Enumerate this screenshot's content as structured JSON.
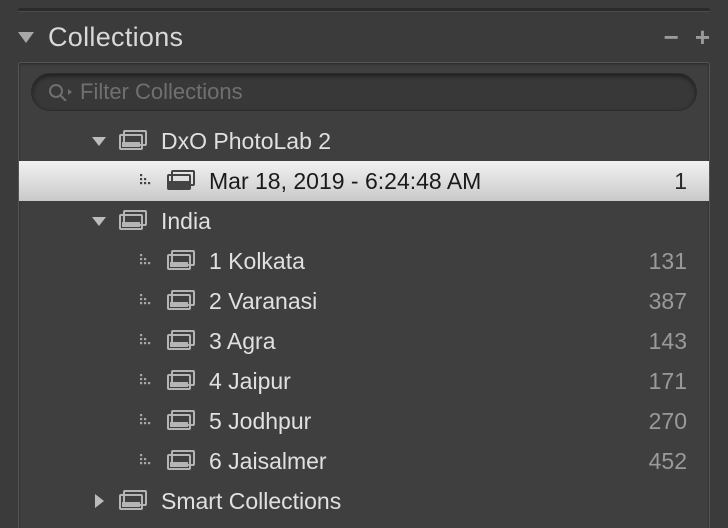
{
  "header": {
    "title": "Collections"
  },
  "filter": {
    "placeholder": "Filter Collections"
  },
  "tree": {
    "items": [
      {
        "kind": "set",
        "expanded": true,
        "depth": 0,
        "label": "DxO PhotoLab 2",
        "selected": false
      },
      {
        "kind": "collection",
        "depth": 1,
        "label": "Mar 18, 2019 - 6:24:48 AM",
        "count": "1",
        "selected": true
      },
      {
        "kind": "set",
        "expanded": true,
        "depth": 0,
        "label": "India",
        "selected": false
      },
      {
        "kind": "collection",
        "depth": 1,
        "label": "1 Kolkata",
        "count": "131",
        "selected": false
      },
      {
        "kind": "collection",
        "depth": 1,
        "label": "2 Varanasi",
        "count": "387",
        "selected": false
      },
      {
        "kind": "collection",
        "depth": 1,
        "label": "3 Agra",
        "count": "143",
        "selected": false
      },
      {
        "kind": "collection",
        "depth": 1,
        "label": "4 Jaipur",
        "count": "171",
        "selected": false
      },
      {
        "kind": "collection",
        "depth": 1,
        "label": "5 Jodhpur",
        "count": "270",
        "selected": false
      },
      {
        "kind": "collection",
        "depth": 1,
        "label": "6 Jaisalmer",
        "count": "452",
        "selected": false
      },
      {
        "kind": "set",
        "expanded": false,
        "depth": 0,
        "label": "Smart Collections",
        "selected": false
      }
    ]
  }
}
